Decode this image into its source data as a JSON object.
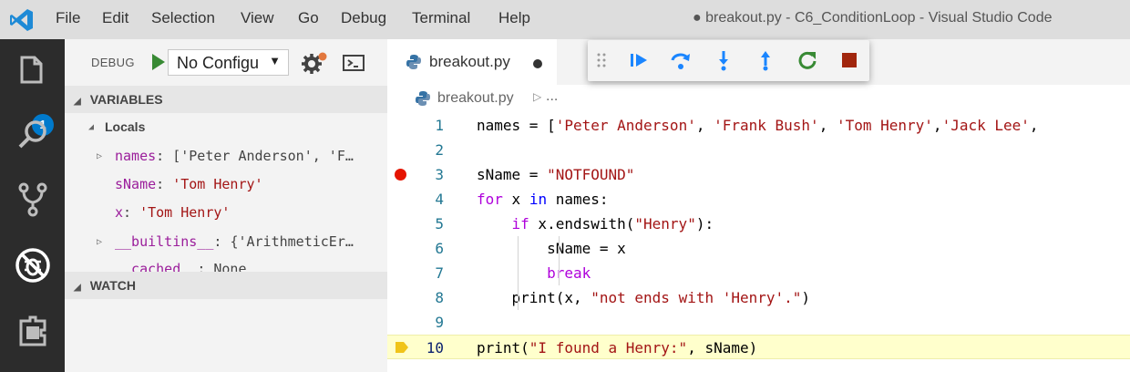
{
  "window": {
    "title": "● breakout.py - C6_ConditionLoop - Visual Studio Code"
  },
  "menu": [
    "File",
    "Edit",
    "Selection",
    "View",
    "Go",
    "Debug",
    "Terminal",
    "Help"
  ],
  "activity_bar": {
    "explorer_badge": "1",
    "icons": [
      "files-icon",
      "search-icon",
      "source-control-icon",
      "debug-icon",
      "extensions-icon"
    ]
  },
  "sidebar": {
    "debug_label": "DEBUG",
    "config_value": "No Configu",
    "sections": {
      "variables": "VARIABLES",
      "locals": "Locals",
      "watch": "WATCH"
    },
    "variables": [
      {
        "name": "names",
        "value": "['Peter Anderson', 'F…"
      },
      {
        "name": "sName",
        "value": "'Tom Henry'"
      },
      {
        "name": "x",
        "value": "'Tom Henry'"
      },
      {
        "name": "__builtins__",
        "value": "{'ArithmeticEr…"
      },
      {
        "name": "__cached__",
        "value": "None"
      }
    ]
  },
  "editor": {
    "tab_label": "breakout.py",
    "breadcrumb_file": "breakout.py",
    "breadcrumb_more": "...",
    "line_numbers": [
      "1",
      "2",
      "3",
      "4",
      "5",
      "6",
      "7",
      "8",
      "9",
      "10"
    ]
  },
  "colors": {
    "accent": "#007acc",
    "breakpoint": "#e51400",
    "current_line": "#ffffcc",
    "current_arrow": "#f0c419",
    "debug_start": "#388a34",
    "stop": "#a1260d"
  }
}
